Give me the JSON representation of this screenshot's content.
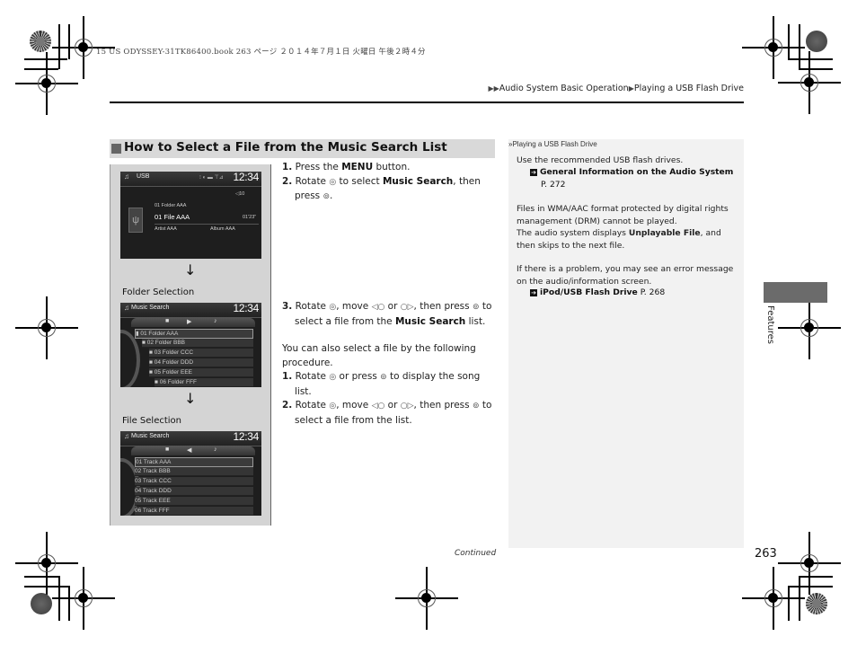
{
  "print_header": "15 US ODYSSEY-31TK86400.book  263 ページ  ２０１４年７月１日  火曜日  午後２時４分",
  "breadcrumb": {
    "prefix_icon": "double-arrow-icon",
    "items": [
      "Audio System Basic Operation",
      "Playing a USB Flash Drive"
    ]
  },
  "section": {
    "title": "How to Select a File from the Music Search List"
  },
  "screens": {
    "usb": {
      "title": "USB",
      "clock": "12:34",
      "status": "⁝ ◐ ▬ ⊤⊿",
      "volume": "◁10",
      "folder": "01  Folder AAA",
      "file": "01 File AAA",
      "time": "01'23\"",
      "artist": "Artist AAA",
      "album": "Album AAA"
    },
    "folder_caption": "Folder Selection",
    "folder": {
      "title": "Music Search",
      "clock": "12:34",
      "rows": [
        "01 Folder AAA",
        "02 Folder BBB",
        "03 Folder CCC",
        "04 Folder DDD",
        "05 Folder EEE",
        "06 Folder FFF"
      ]
    },
    "file_caption": "File Selection",
    "file": {
      "title": "Music Search",
      "clock": "12:34",
      "rows": [
        "01 Track AAA",
        "02 Track BBB",
        "03 Track CCC",
        "04 Track DDD",
        "05 Track EEE",
        "06 Track FFF"
      ]
    }
  },
  "steps": {
    "s1": {
      "num": "1.",
      "pre": "Press the ",
      "bold": "MENU",
      "post": " button."
    },
    "s2": {
      "num": "2.",
      "pre": "Rotate ",
      "mid": " to select ",
      "bold": "Music Search",
      "post": ", then",
      "line2": "press ",
      "end": "."
    },
    "s3": {
      "num": "3.",
      "pre": "Rotate ",
      "a": ", move ",
      "or": " or ",
      "b": ", then press ",
      "c": " to",
      "line2": "select a file from the ",
      "bold": "Music Search",
      "end": " list."
    },
    "alt_intro": "You can also select a file by the following procedure.",
    "a1": {
      "num": "1.",
      "pre": "Rotate ",
      "mid": " or press ",
      "post": " to display the song",
      "line2": "list."
    },
    "a2": {
      "num": "2.",
      "pre": "Rotate ",
      "a": ", move ",
      "or": " or ",
      "b": ", then press ",
      "c": " to",
      "line2": "select a file from the list."
    }
  },
  "sidebar": {
    "header": "Playing a USB Flash Drive",
    "p1": "Use the recommended USB flash drives.",
    "ref1_label": "General Information on the Audio System",
    "ref1_page": "P. 272",
    "p2": "Files in WMA/AAC format protected by digital rights management (DRM) cannot be played.",
    "p3_pre": "The audio system displays ",
    "p3_bold": "Unplayable File",
    "p3_post": ", and then skips to the next file.",
    "p4": "If there is a problem, you may see an error message on the audio/information screen.",
    "ref2_label": "iPod/USB Flash Drive",
    "ref2_page": "P. 268"
  },
  "side_tab": "Features",
  "footer": {
    "continued": "Continued",
    "page_number": "263"
  }
}
